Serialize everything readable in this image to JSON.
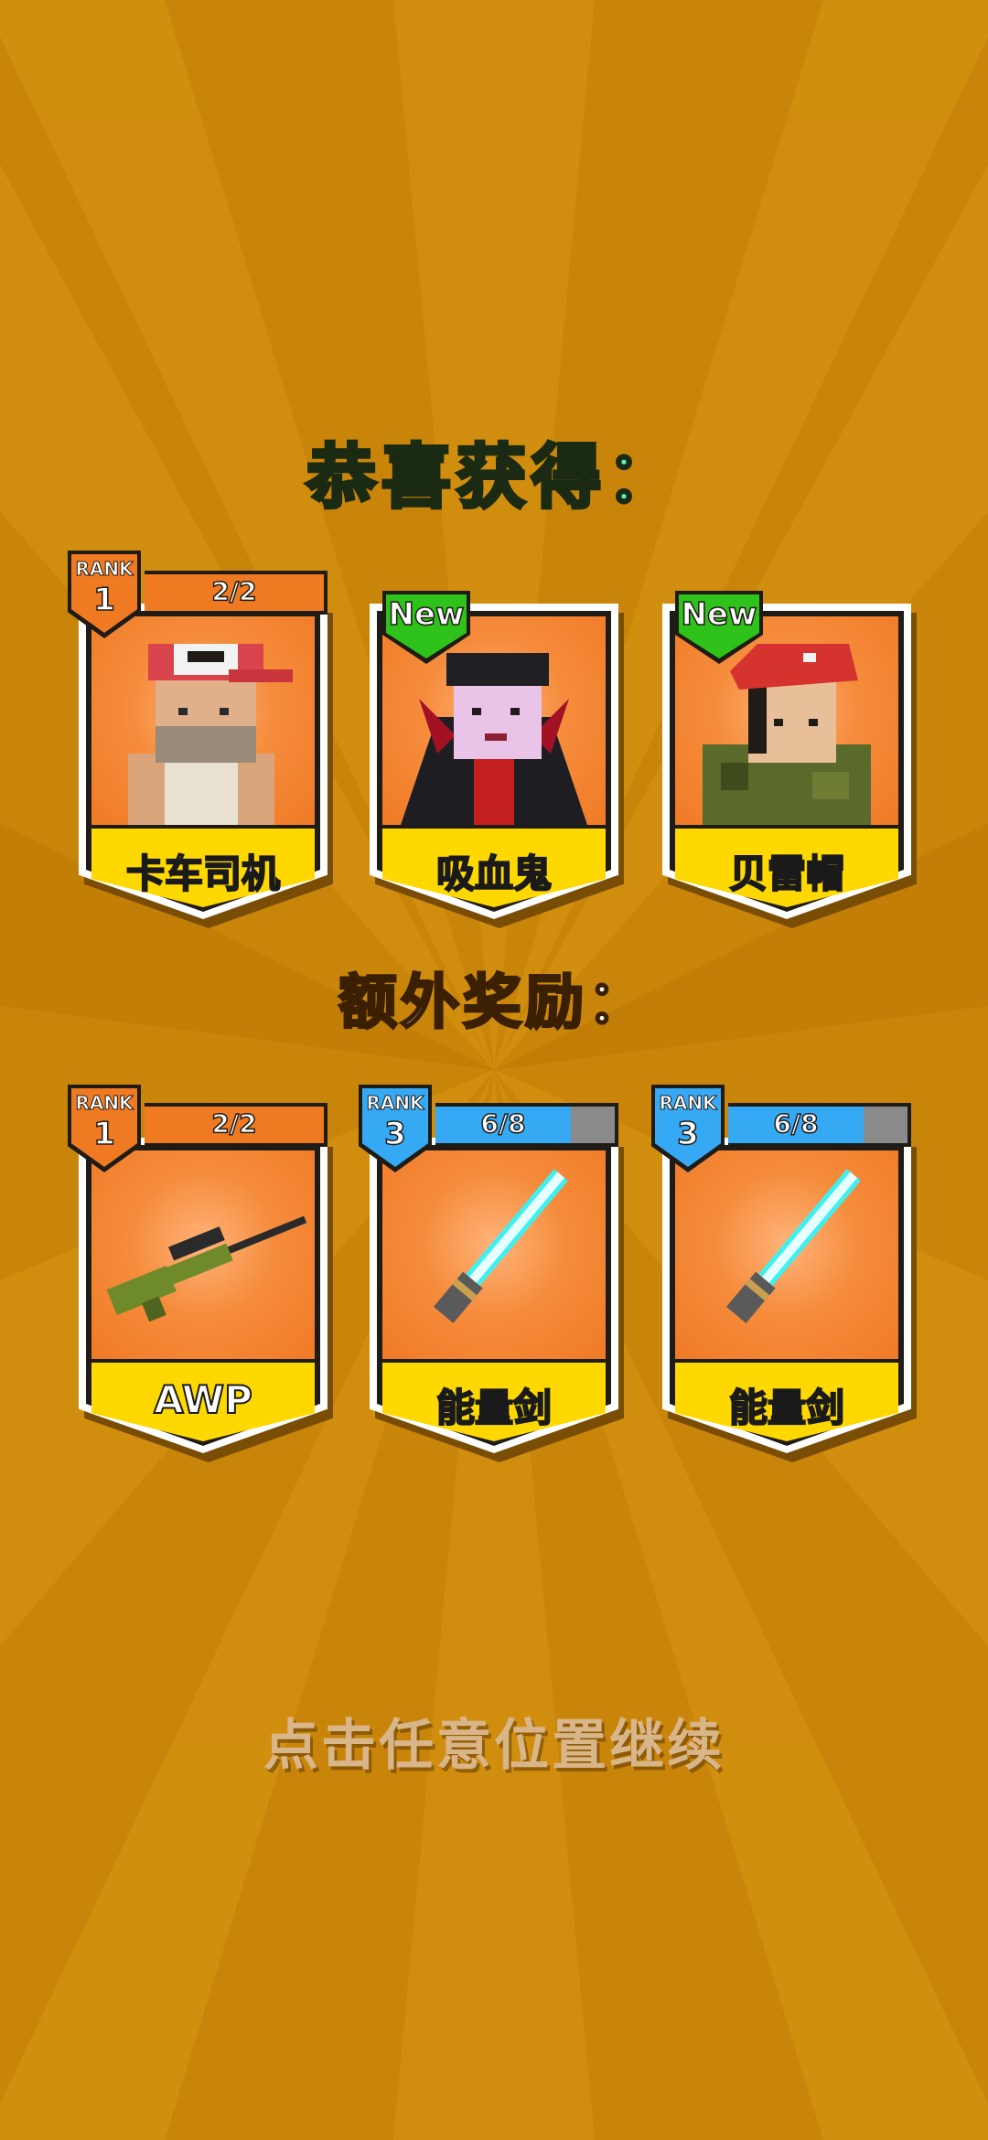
{
  "title": "恭喜获得：",
  "bonus_title": "额外奖励：",
  "continue_hint": "点击任意位置继续",
  "rank_word": "RANK",
  "new_badge": "New",
  "rewards": [
    {
      "name": "卡车司机",
      "rank": "1",
      "progress": "2/2",
      "is_new": false,
      "icon": "trucker-character"
    },
    {
      "name": "吸血鬼",
      "is_new": true,
      "icon": "vampire-character"
    },
    {
      "name": "贝雷帽",
      "is_new": true,
      "icon": "beret-soldier-character"
    }
  ],
  "bonus": [
    {
      "name": "AWP",
      "rank": "1",
      "progress": "2/2",
      "icon": "sniper-rifle-icon",
      "bar_color": "#f07a22"
    },
    {
      "name": "能量剑",
      "rank": "3",
      "progress": "6/8",
      "icon": "energy-sword-icon",
      "bar_color": "#36a9f5"
    },
    {
      "name": "能量剑",
      "rank": "3",
      "progress": "6/8",
      "icon": "energy-sword-icon",
      "bar_color": "#36a9f5"
    }
  ],
  "colors": {
    "background": "#c98509",
    "card_label": "#ffd800",
    "new_tag": "#2ec21a",
    "title": "#5df0c0"
  }
}
